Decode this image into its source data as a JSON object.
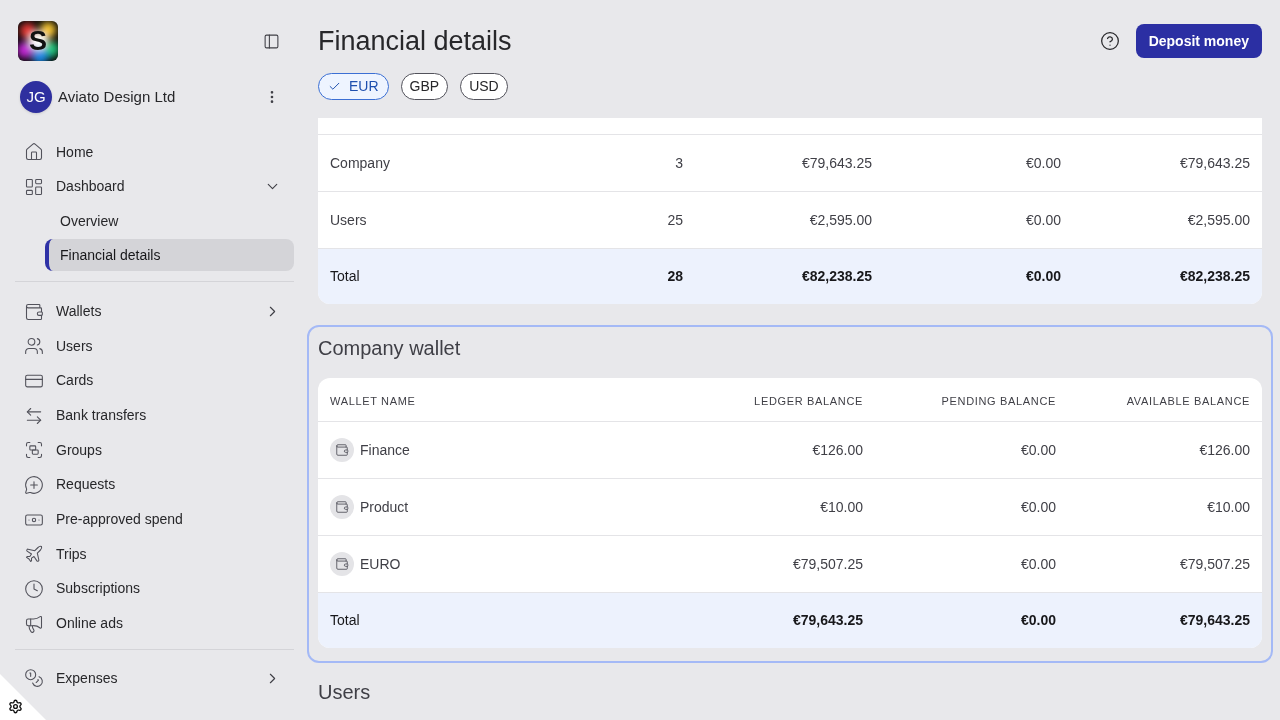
{
  "sidebar": {
    "logo": {
      "letter": "S"
    },
    "account": {
      "initials": "JG",
      "name": "Aviato Design Ltd"
    },
    "sections": [
      {
        "items": [
          {
            "label": "Home",
            "selected": false
          },
          {
            "label": "Dashboard",
            "selected": false,
            "expanded": true,
            "children": [
              {
                "label": "Overview",
                "selected": false
              },
              {
                "label": "Financial details",
                "selected": true
              }
            ]
          }
        ]
      },
      {
        "items": [
          {
            "label": "Wallets",
            "selected": false,
            "expanded": false
          },
          {
            "label": "Users",
            "selected": false
          },
          {
            "label": "Cards",
            "selected": false
          },
          {
            "label": "Bank transfers",
            "selected": false
          },
          {
            "label": "Groups",
            "selected": false
          },
          {
            "label": "Requests",
            "selected": false
          },
          {
            "label": "Pre-approved spend",
            "selected": false
          },
          {
            "label": "Trips",
            "selected": false
          },
          {
            "label": "Subscriptions",
            "selected": false
          },
          {
            "label": "Online ads",
            "selected": false
          }
        ]
      },
      {
        "items": [
          {
            "label": "Expenses",
            "selected": false,
            "expanded": false
          }
        ]
      }
    ]
  },
  "header": {
    "title": "Financial details",
    "primary_button": "Deposit money"
  },
  "currency_filters": [
    {
      "label": "EUR",
      "selected": true
    },
    {
      "label": "GBP",
      "selected": false
    },
    {
      "label": "USD",
      "selected": false
    }
  ],
  "summary_table": {
    "rows": [
      {
        "kind": "row",
        "cells": [
          "Company",
          "3",
          "€79,643.25",
          "€0.00",
          "€79,643.25"
        ]
      },
      {
        "kind": "row",
        "cells": [
          "Users",
          "25",
          "€2,595.00",
          "€0.00",
          "€2,595.00"
        ]
      },
      {
        "kind": "total",
        "cells": [
          "Total",
          "28",
          "€82,238.25",
          "€0.00",
          "€82,238.25"
        ]
      }
    ]
  },
  "company_wallet": {
    "title": "Company wallet",
    "highlighted": true,
    "columns": [
      "WALLET NAME",
      "LEDGER BALANCE",
      "PENDING BALANCE",
      "AVAILABLE BALANCE"
    ],
    "rows": [
      {
        "kind": "wallet",
        "cells": [
          "Finance",
          "€126.00",
          "€0.00",
          "€126.00"
        ]
      },
      {
        "kind": "wallet",
        "cells": [
          "Product",
          "€10.00",
          "€0.00",
          "€10.00"
        ]
      },
      {
        "kind": "wallet",
        "cells": [
          "EURO",
          "€79,507.25",
          "€0.00",
          "€79,507.25"
        ]
      },
      {
        "kind": "total",
        "cells": [
          "Total",
          "€79,643.25",
          "€0.00",
          "€79,643.25"
        ]
      }
    ]
  },
  "users_section": {
    "title": "Users"
  }
}
